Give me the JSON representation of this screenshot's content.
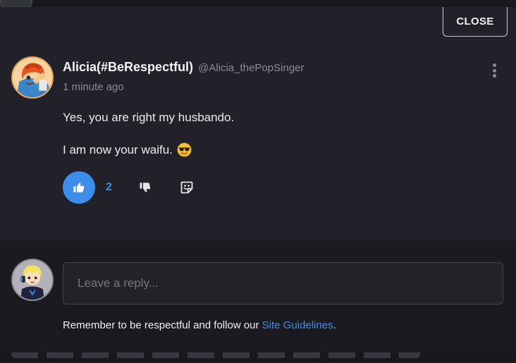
{
  "modal": {
    "close_label": "CLOSE"
  },
  "comment": {
    "author_name": "Alicia(#BeRespectful)",
    "author_handle": "@Alicia_thePopSinger",
    "timestamp": "1 minute ago",
    "paragraphs": [
      "Yes, you are right my husbando.",
      "I am now your waifu."
    ],
    "emoji": "sunglasses-face-emoji",
    "likes": "2",
    "icons": {
      "menu": "kebab-menu-icon",
      "like": "thumbs-up-icon",
      "dislike": "thumbs-down-icon",
      "react": "sticker-reaction-icon"
    }
  },
  "reply": {
    "placeholder": "Leave a reply...",
    "notice_prefix": "Remember to be respectful and follow our ",
    "notice_link": "Site Guidelines",
    "notice_suffix": "."
  },
  "colors": {
    "accent": "#3c8eea",
    "modal_bg": "#222129",
    "reply_bg": "#1b1a21"
  }
}
